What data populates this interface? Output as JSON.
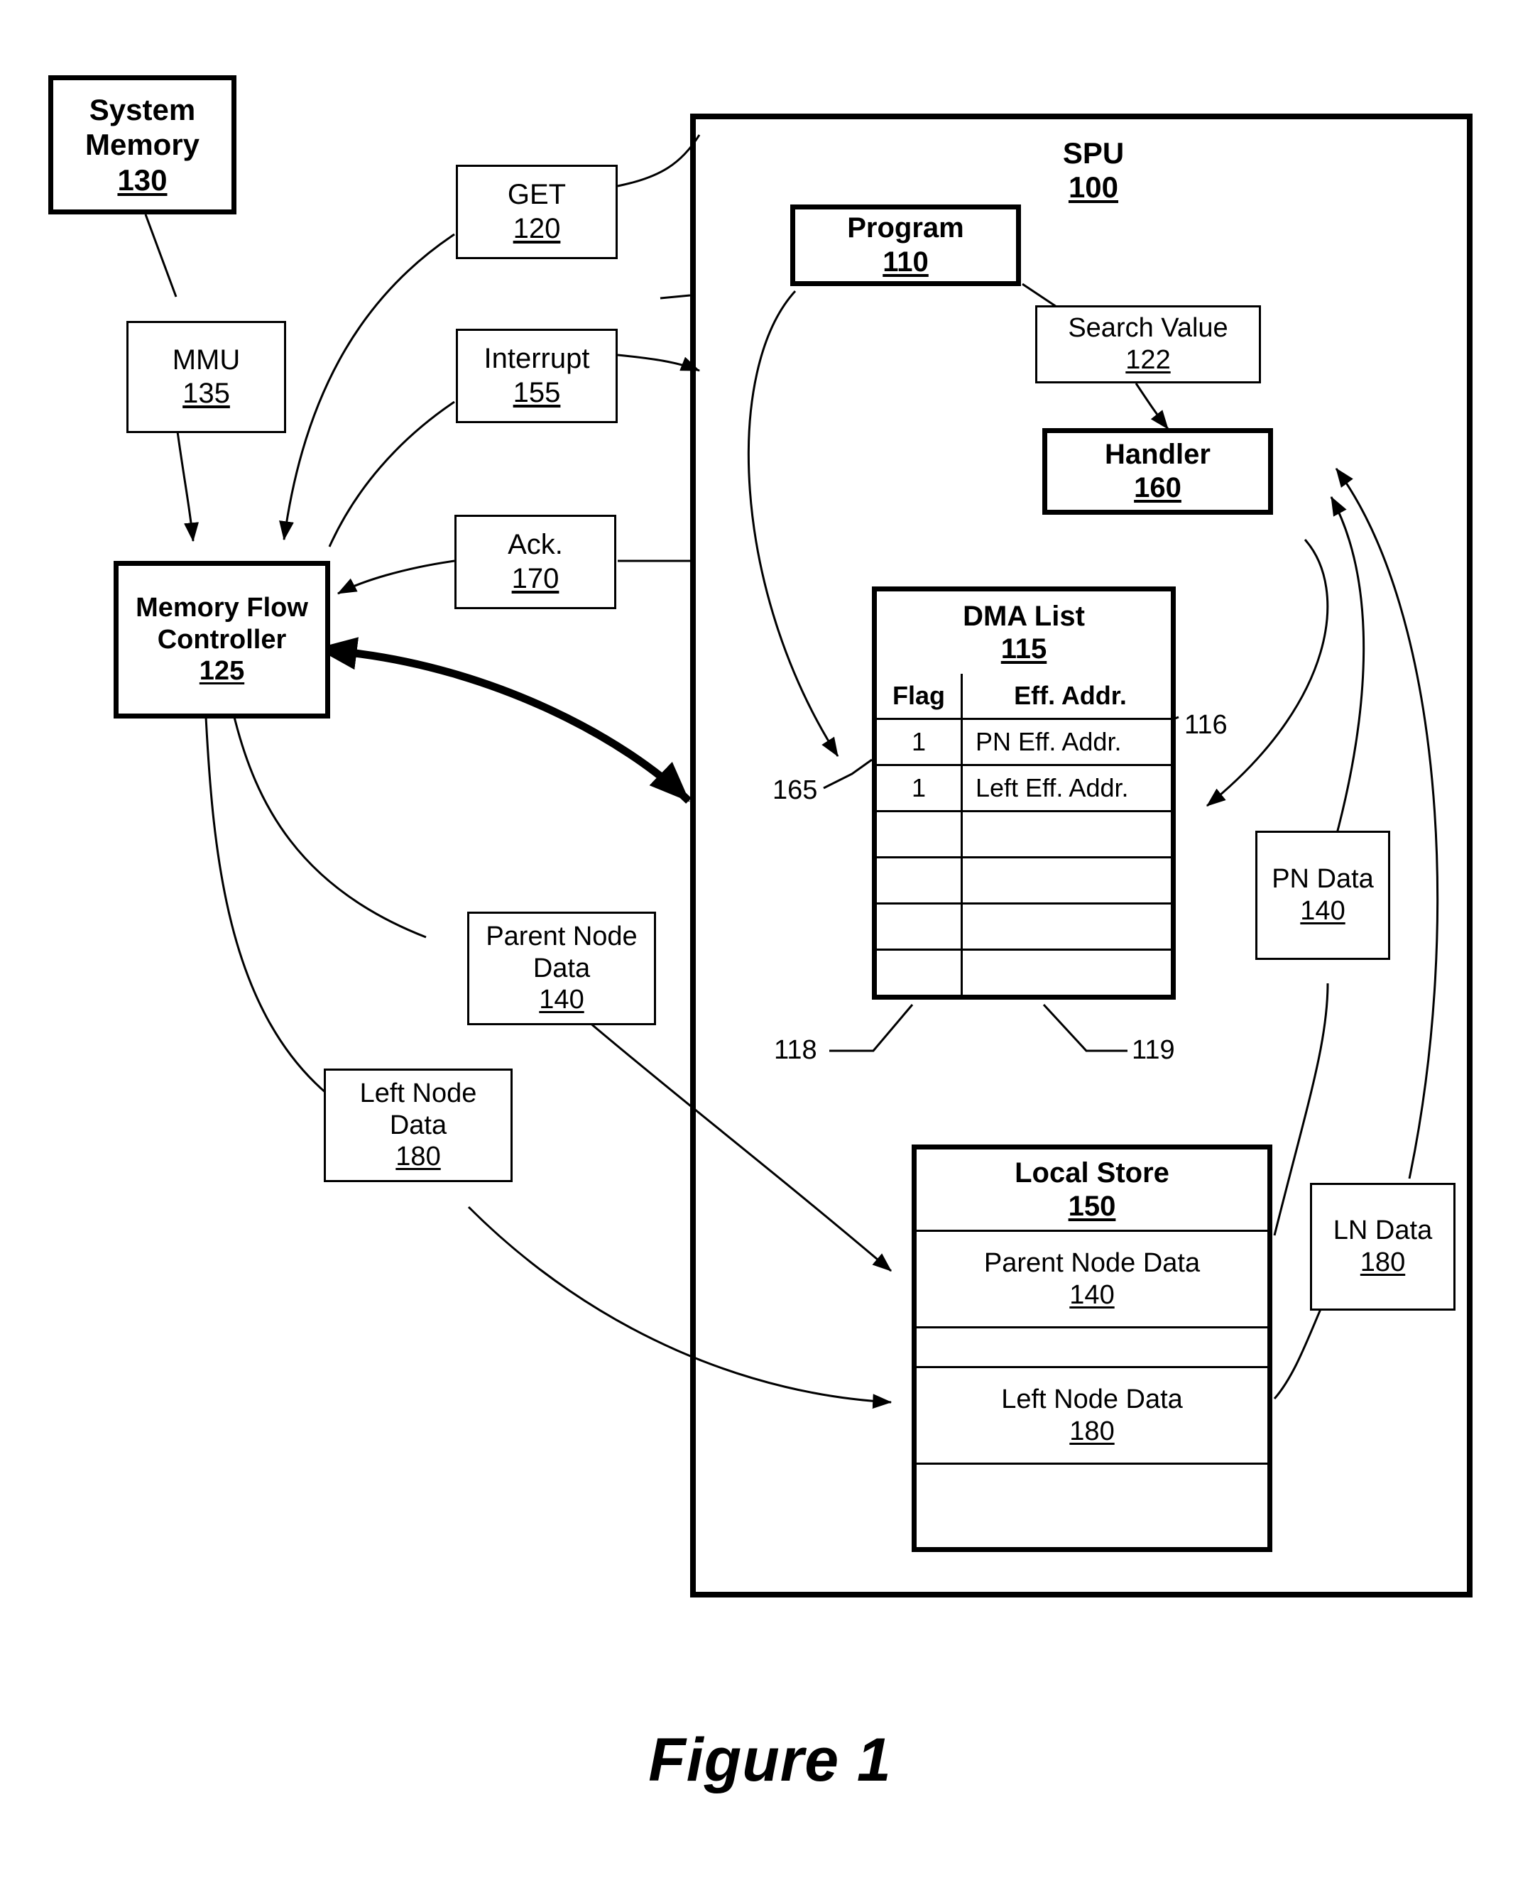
{
  "figure": {
    "caption": "Figure 1"
  },
  "spu": {
    "label": "SPU",
    "number": "100"
  },
  "boxes": {
    "system_memory": {
      "line1": "System",
      "line2": "Memory",
      "number": "130"
    },
    "mmu": {
      "label": "MMU",
      "number": "135"
    },
    "mfc": {
      "line1": "Memory Flow",
      "line2": "Controller",
      "number": "125"
    },
    "get": {
      "label": "GET",
      "number": "120"
    },
    "interrupt": {
      "label": "Interrupt",
      "number": "155"
    },
    "ack": {
      "label": "Ack.",
      "number": "170"
    },
    "program": {
      "label": "Program",
      "number": "110"
    },
    "search_value": {
      "label": "Search Value",
      "number": "122"
    },
    "handler": {
      "label": "Handler",
      "number": "160"
    },
    "parent_node_data": {
      "line1": "Parent Node",
      "line2": "Data",
      "number": "140"
    },
    "left_node_data": {
      "line1": "Left Node",
      "line2": "Data",
      "number": "180"
    },
    "pn_data": {
      "label": "PN Data",
      "number": "140"
    },
    "ln_data": {
      "label": "LN Data",
      "number": "180"
    }
  },
  "dma_list": {
    "title": "DMA List",
    "number": "115",
    "columns": [
      "Flag",
      "Eff. Addr."
    ],
    "rows": [
      {
        "flag": "1",
        "addr": "PN Eff. Addr."
      },
      {
        "flag": "1",
        "addr": "Left Eff. Addr."
      },
      {
        "flag": "",
        "addr": ""
      },
      {
        "flag": "",
        "addr": ""
      },
      {
        "flag": "",
        "addr": ""
      },
      {
        "flag": "",
        "addr": ""
      }
    ]
  },
  "local_store": {
    "title": "Local Store",
    "number": "150",
    "entries": [
      {
        "label": "Parent Node Data",
        "number": "140"
      },
      {
        "label": "Left Node Data",
        "number": "180"
      }
    ]
  },
  "reference_numbers": {
    "r116": "116",
    "r165": "165",
    "r118": "118",
    "r119": "119"
  },
  "colors": {
    "line": "#000000",
    "background": "#ffffff"
  }
}
